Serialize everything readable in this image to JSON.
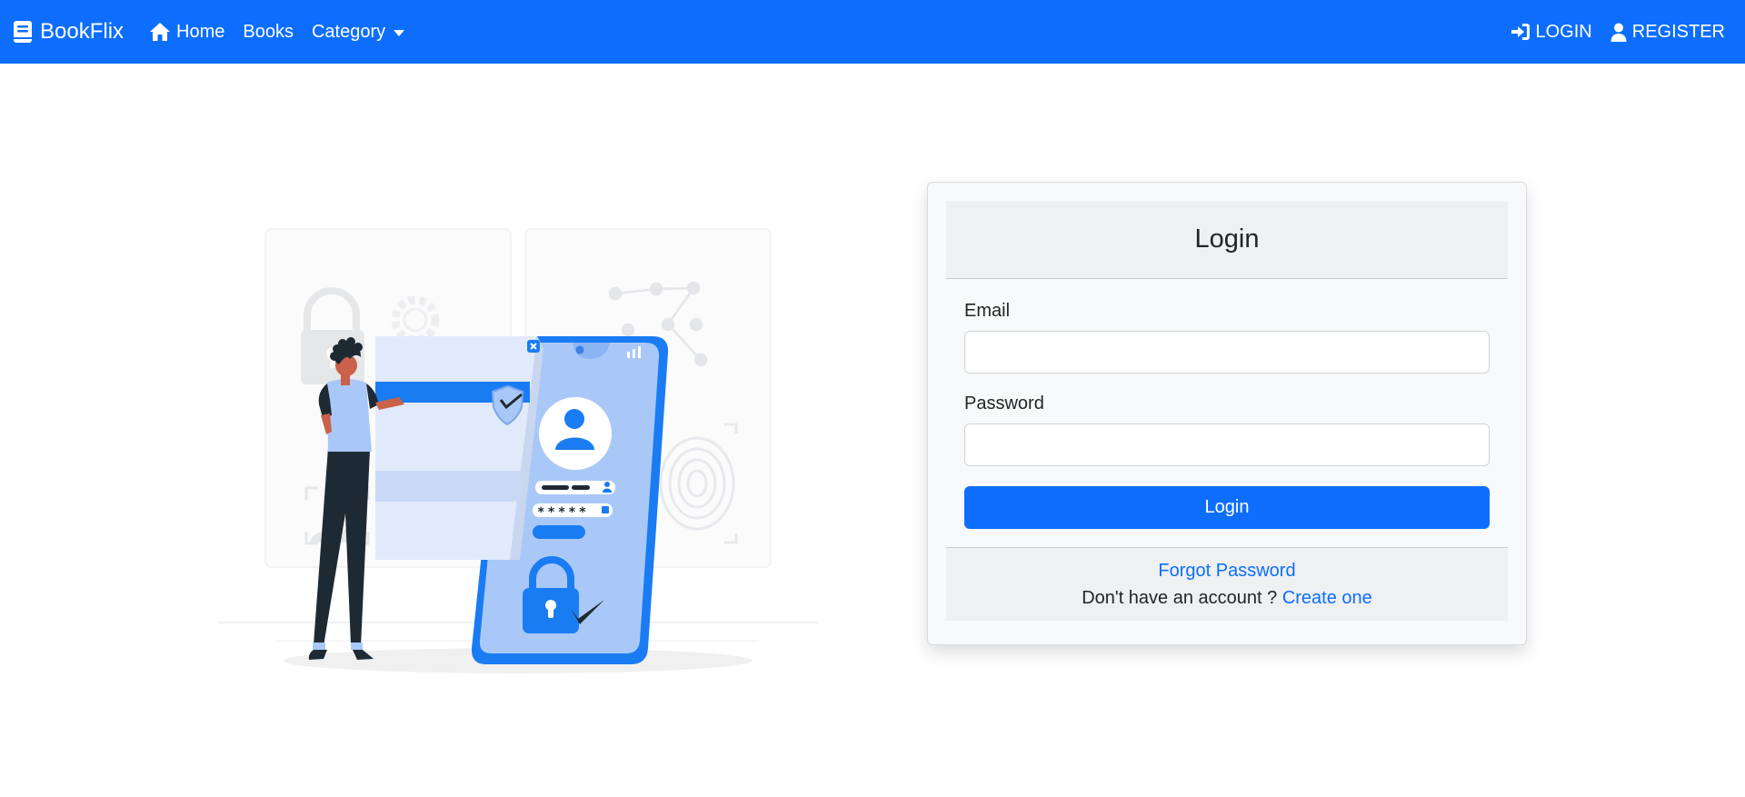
{
  "navbar": {
    "brand": "BookFlix",
    "items": [
      {
        "label": "Home"
      },
      {
        "label": "Books"
      },
      {
        "label": "Category"
      }
    ],
    "right": [
      {
        "label": "LOGIN"
      },
      {
        "label": "REGISTER"
      }
    ],
    "color": "#0d6efd"
  },
  "login_card": {
    "title": "Login",
    "email_label": "Email",
    "email_value": "",
    "password_label": "Password",
    "password_value": "",
    "submit_label": "Login",
    "forgot_label": "Forgot Password",
    "no_account_text": "Don't have an account ?",
    "create_label": "Create one"
  },
  "illustration": {
    "password_mask": "*****"
  }
}
